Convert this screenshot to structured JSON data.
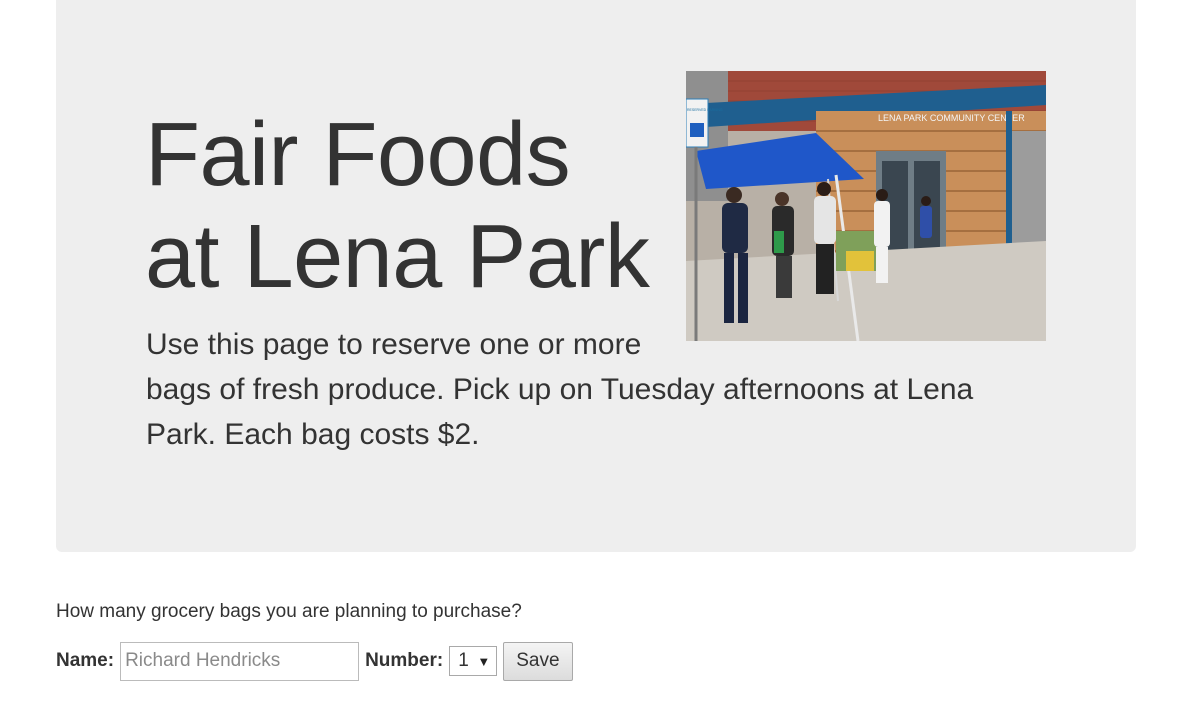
{
  "hero": {
    "title_line1": "Fair Foods",
    "title_line2": "at Lena Park",
    "lead_line1": "Use this page to reserve one or more",
    "lead_line2": "bags of fresh produce. Pick up on Tuesday afternoons at Lena",
    "lead_line3": "Park. Each bag costs $2.",
    "photo": {
      "sign_text": "LENA PARK COMMUNITY CENTER",
      "parking_sign": "RESERVED PARKING"
    }
  },
  "form": {
    "question": "How many grocery bags you are planning to purchase?",
    "name_label": "Name:",
    "name_placeholder": "Richard Hendricks",
    "name_value": "",
    "number_label": "Number:",
    "number_selected": "1",
    "save_label": "Save"
  },
  "colors": {
    "hero_bg": "#eeeeee",
    "text": "#333333",
    "tent_blue": "#1f57c9",
    "brick": "#a0493a"
  },
  "icons": {
    "select_arrow": "chevron-down-icon"
  }
}
